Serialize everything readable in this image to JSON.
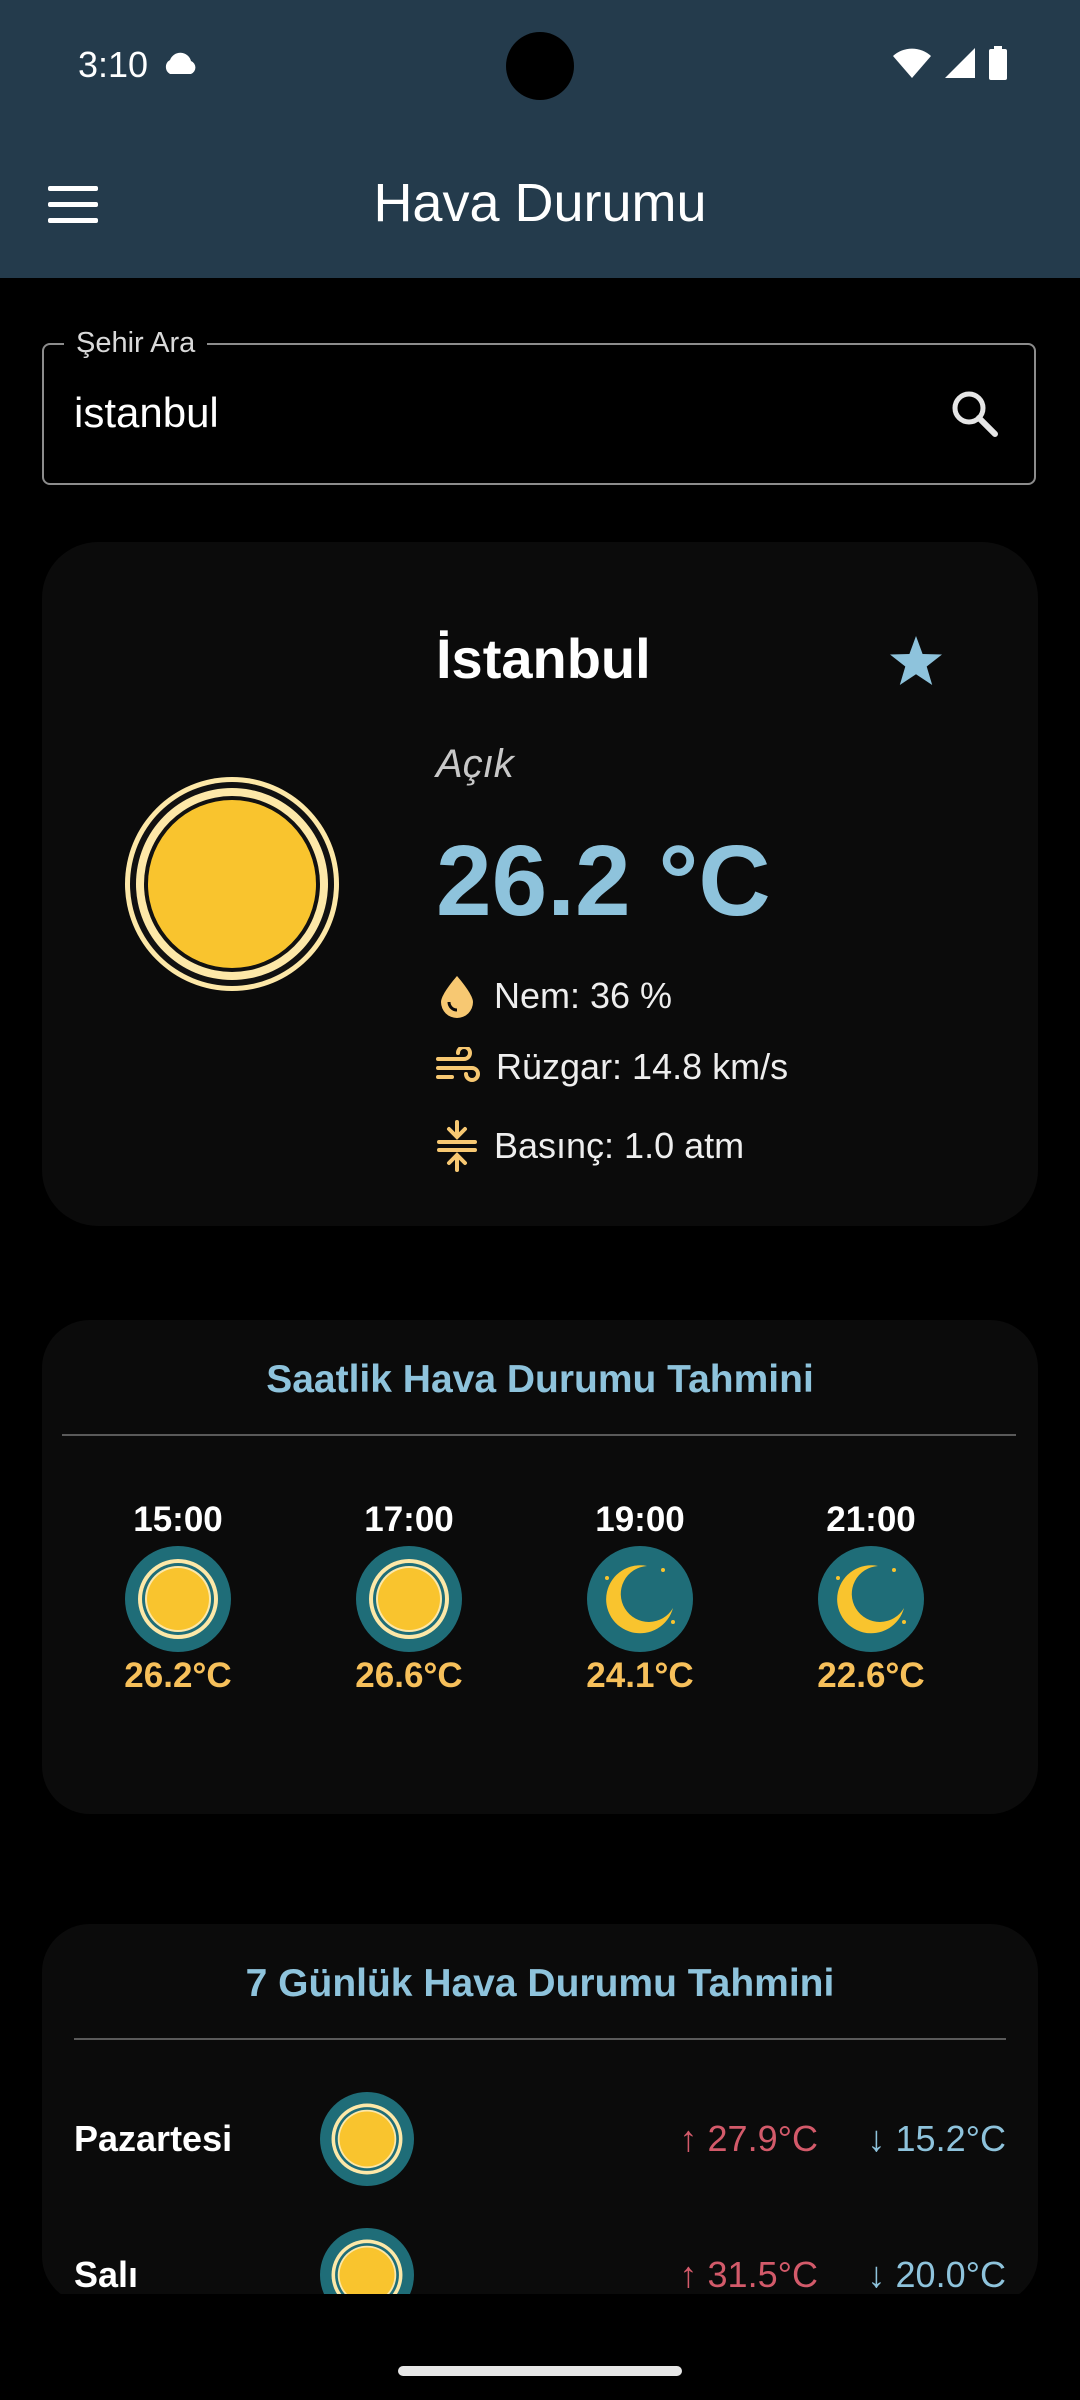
{
  "status_bar": {
    "time": "3:10"
  },
  "app_bar": {
    "title": "Hava Durumu"
  },
  "search": {
    "legend": "Şehir Ara",
    "value": "istanbul"
  },
  "current": {
    "city": "İstanbul",
    "condition": "Açık",
    "temperature": "26.2 °C",
    "humidity": "Nem: 36 %",
    "wind": "Rüzgar: 14.8 km/s",
    "pressure": "Basınç: 1.0 atm"
  },
  "hourly": {
    "title": "Saatlik Hava Durumu Tahmini",
    "items": [
      {
        "time": "15:00",
        "temp": "26.2°C",
        "icon": "sun-icon"
      },
      {
        "time": "17:00",
        "temp": "26.6°C",
        "icon": "sun-icon"
      },
      {
        "time": "19:00",
        "temp": "24.1°C",
        "icon": "moon-icon"
      },
      {
        "time": "21:00",
        "temp": "22.6°C",
        "icon": "moon-icon"
      }
    ]
  },
  "daily": {
    "title": "7 Günlük Hava Durumu Tahmini",
    "items": [
      {
        "day": "Pazartesi",
        "max": "↑ 27.9°C",
        "min": "↓ 15.2°C",
        "icon": "sun-icon"
      },
      {
        "day": "Salı",
        "max": "↑ 31.5°C",
        "min": "↓ 20.0°C",
        "icon": "sun-icon"
      }
    ]
  },
  "colors": {
    "app_bar": "#243b4c",
    "accent": "#8ec3dc",
    "sun": "#f9c42e",
    "hourly_temp": "#f7c05a",
    "max_temp": "#d35a6a"
  }
}
